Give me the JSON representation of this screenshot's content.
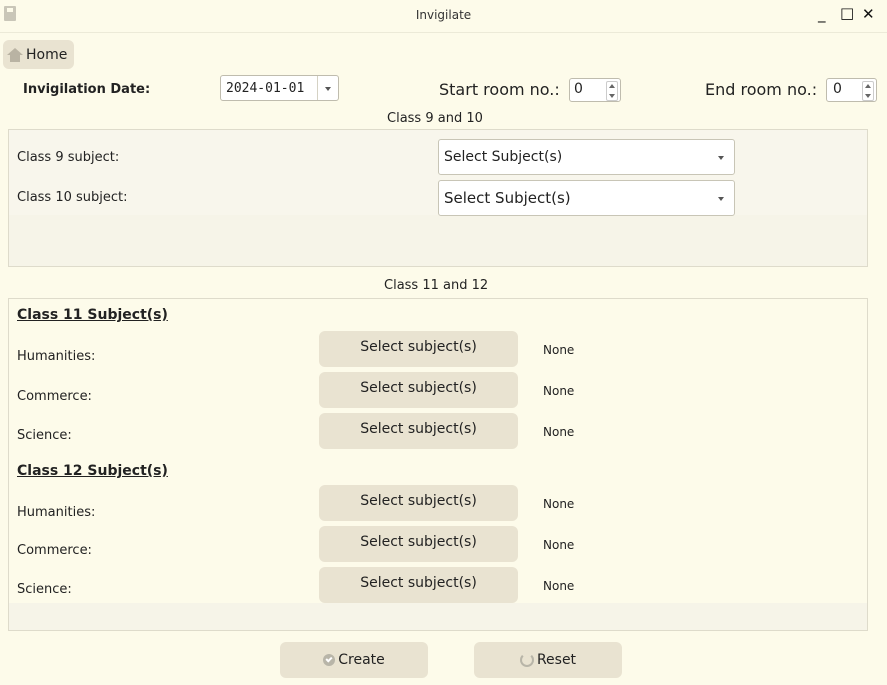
{
  "window": {
    "title": "Invigilate",
    "minimize": "_",
    "maximize": "□",
    "close": "✕"
  },
  "home": {
    "label": "Home"
  },
  "filters": {
    "date_label": "Invigilation Date:",
    "date_value": "2024-01-01",
    "start_room_label": "Start room no.:",
    "start_room_value": "0",
    "end_room_label": "End room no.:",
    "end_room_value": "0"
  },
  "class_9_10": {
    "heading": "Class 9 and 10",
    "rows": [
      {
        "label": "Class 9 subject:",
        "value": "Select Subject(s)"
      },
      {
        "label": "Class 10 subject:",
        "value": "Select Subject(s)"
      }
    ]
  },
  "class_11_12": {
    "heading": "Class 11 and 12",
    "class_11": {
      "title": "Class 11 Subject(s)",
      "rows": [
        {
          "label": "Humanities:",
          "button": "Select subject(s)",
          "status": "None"
        },
        {
          "label": "Commerce:",
          "button": "Select subject(s)",
          "status": "None"
        },
        {
          "label": "Science:",
          "button": "Select subject(s)",
          "status": "None"
        }
      ]
    },
    "class_12": {
      "title": "Class 12 Subject(s)",
      "rows": [
        {
          "label": "Humanities:",
          "button": "Select subject(s)",
          "status": "None"
        },
        {
          "label": "Commerce:",
          "button": "Select subject(s)",
          "status": "None"
        },
        {
          "label": "Science:",
          "button": "Select subject(s)",
          "status": "None"
        }
      ]
    }
  },
  "actions": {
    "create": "Create",
    "reset": "Reset"
  },
  "colors": {
    "background": "#fdfbea",
    "button": "#e9e3d1",
    "panel": "#f6f4e8"
  }
}
